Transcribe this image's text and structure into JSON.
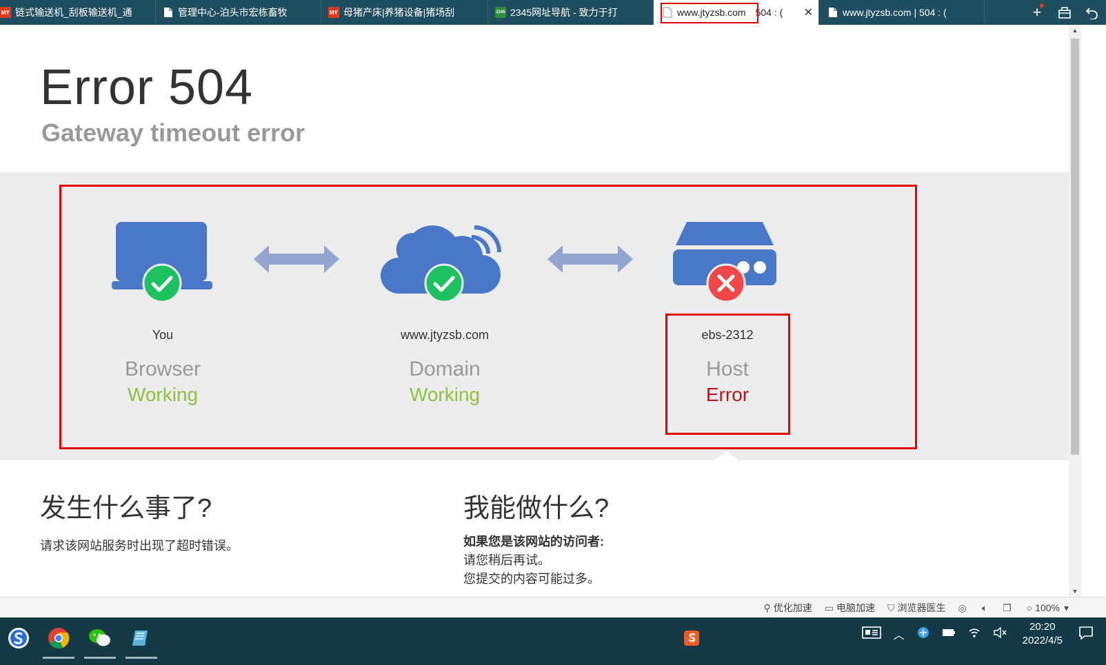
{
  "tabs": [
    {
      "favicon": "my-logo-icon",
      "title": "链式输送机_刮板输送机_通"
    },
    {
      "favicon": "page-icon",
      "title": "管理中心-泊头市宏栋畜牧"
    },
    {
      "favicon": "my-logo-icon",
      "title": "母猪产床|养猪设备|猪场刮"
    },
    {
      "favicon": "2345-logo-icon",
      "title": "2345网址导航 - 致力于打"
    },
    {
      "favicon": "page-icon",
      "title": "www.jtyzsb.com",
      "suffix": "504 : (",
      "active": true
    },
    {
      "favicon": "page-icon",
      "title": "www.jtyzsb.com | 504 : ("
    }
  ],
  "favicon_text": {
    "my": "MY",
    "s2345": "2345"
  },
  "tab_tools": [
    "new-tab-icon",
    "restore-tabs-icon",
    "undo-icon"
  ],
  "hero": {
    "title": "Error 504",
    "subtitle": "Gateway timeout error"
  },
  "nodes": [
    {
      "location": "You",
      "role": "Browser",
      "state": "Working",
      "status": "ok"
    },
    {
      "location": "www.jtyzsb.com",
      "role": "Domain",
      "state": "Working",
      "status": "ok"
    },
    {
      "location": "ebs-2312",
      "role": "Host",
      "state": "Error",
      "status": "error"
    }
  ],
  "colors": {
    "working": "#90c040",
    "error": "#b0171f",
    "icon_blue": "#4a78c8",
    "check_green": "#1ec15f",
    "cross_red": "#f04748",
    "highlight": "#e30000"
  },
  "what_happened": {
    "heading": "发生什么事了?",
    "body": "请求该网站服务时出现了超时错误。"
  },
  "what_can_i_do": {
    "heading": "我能做什么?",
    "subheading": "如果您是该网站的访问者:",
    "lines": [
      "请您稍后再试。",
      "您提交的内容可能过多。"
    ]
  },
  "statusbar": {
    "items": [
      "优化加速",
      "电脑加速",
      "浏览器医生"
    ],
    "zoom": "100%"
  },
  "taskbar": {
    "apps": [
      "sogou-icon",
      "chrome-icon",
      "wechat-icon",
      "notepad-icon"
    ],
    "time": "20:20",
    "date": "2022/4/5"
  }
}
